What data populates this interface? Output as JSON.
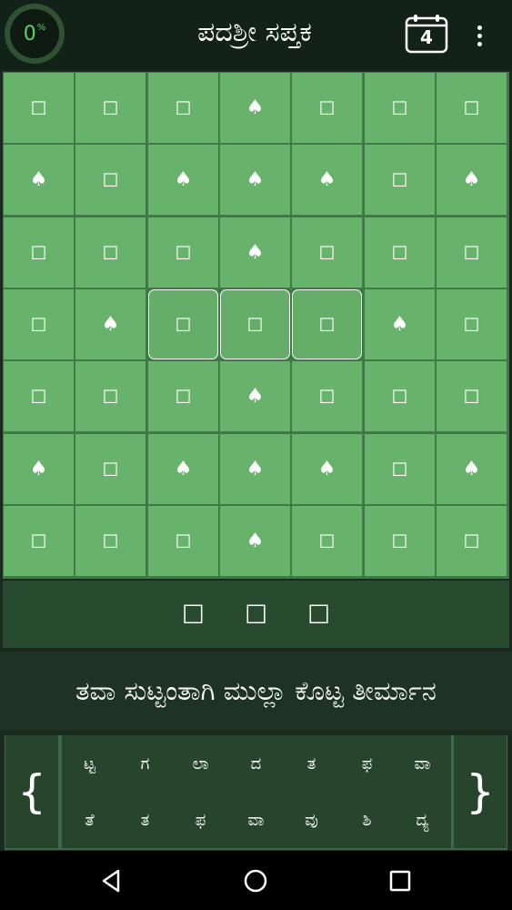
{
  "header": {
    "progress": "0",
    "progress_unit": "%",
    "title": "ಪದಶ್ರೀ ಸಪ್ತಕ",
    "calendar_day": "4"
  },
  "grid": {
    "rows": [
      [
        "box",
        "box",
        "box",
        "spade",
        "box",
        "box",
        "box"
      ],
      [
        "spade",
        "box",
        "spade",
        "spade",
        "spade",
        "box",
        "spade"
      ],
      [
        "box",
        "box",
        "box",
        "spade",
        "box",
        "box",
        "box"
      ],
      [
        "box",
        "spade",
        "box",
        "box",
        "box",
        "spade",
        "box"
      ],
      [
        "box",
        "box",
        "box",
        "spade",
        "box",
        "box",
        "box"
      ],
      [
        "spade",
        "box",
        "spade",
        "spade",
        "spade",
        "box",
        "spade"
      ],
      [
        "box",
        "box",
        "box",
        "spade",
        "box",
        "box",
        "box"
      ]
    ],
    "selected": [
      [
        3,
        2
      ],
      [
        3,
        3
      ],
      [
        3,
        4
      ]
    ],
    "glyphs": {
      "box": "☐",
      "spade": "♠"
    }
  },
  "answer": {
    "slots": [
      "☐",
      "☐",
      "☐"
    ]
  },
  "clue": {
    "text": "ತವಾ ಸುಟ್ಟಂತಾಗಿ ಮುಲ್ಲಾ ಕೊಟ್ಟ ತೀರ್ಮಾನ"
  },
  "letters": {
    "left_brace": "{",
    "right_brace": "}",
    "row1": [
      "ಟ್ಟ",
      "ಗ",
      "ಲಾ",
      "ದ",
      "ತ",
      "ಫ",
      "ವಾ"
    ],
    "row2": [
      "ತೆ",
      "ತ",
      "ಫ",
      "ವಾ",
      "ವು",
      "ಶಿ",
      "ದ್ಯ"
    ]
  },
  "nav": [
    "back-icon",
    "home-icon",
    "recents-icon"
  ]
}
